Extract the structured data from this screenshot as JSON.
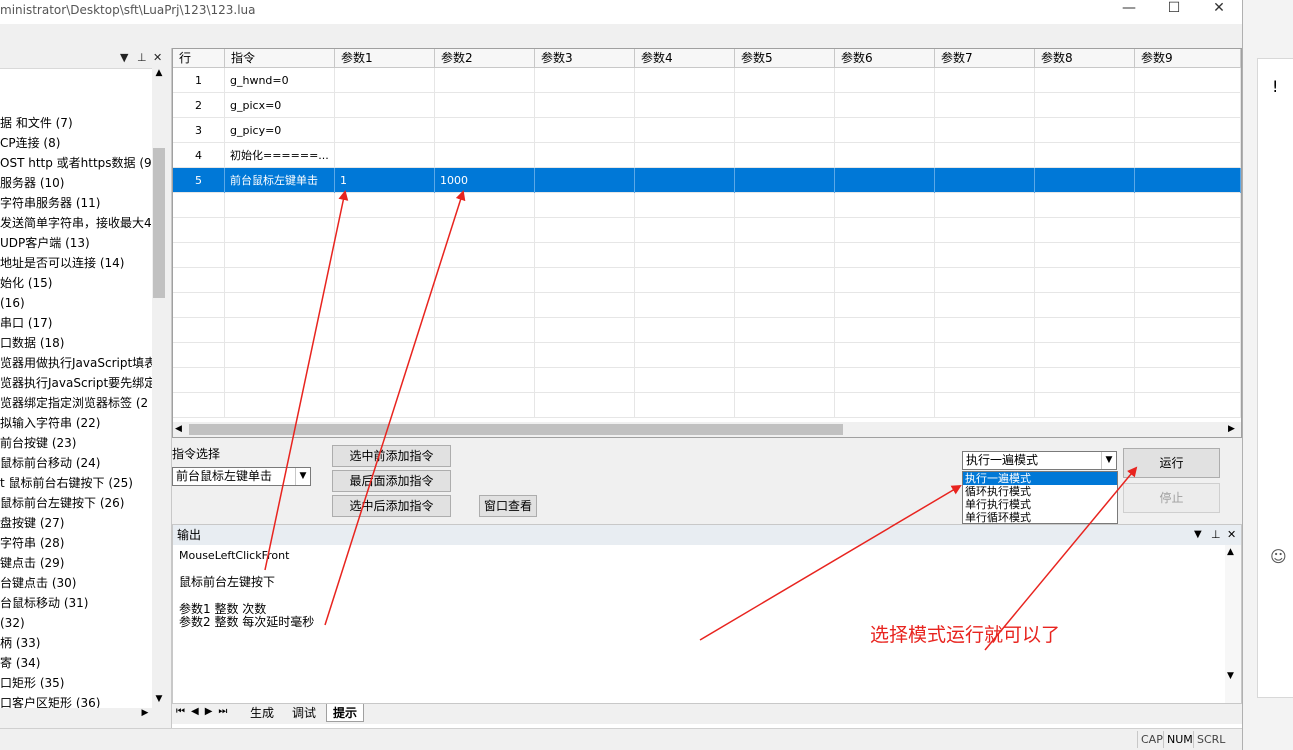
{
  "window": {
    "title": "ministrator\\Desktop\\sft\\LuaPrj\\123\\123.lua",
    "minimize_glyph": "—",
    "maximize_glyph": "☐",
    "close_glyph": "✕"
  },
  "left_panel": {
    "items": [
      "据 和文件 (7)",
      "CP连接 (8)",
      "OST http 或者https数据 (9)",
      "服务器 (10)",
      "字符串服务器 (11)",
      "发送简单字符串，接收最大4",
      "UDP客户端 (13)",
      "地址是否可以连接 (14)",
      "始化 (15)",
      "(16)",
      "串口 (17)",
      "口数据 (18)",
      "览器用做执行JavaScript填表",
      "览器执行JavaScript要先绑定",
      "览器绑定指定浏览器标签 (2",
      "拟输入字符串 (22)",
      "前台按键 (23)",
      "鼠标前台移动 (24)",
      "t  鼠标前台右键按下 (25)",
      "  鼠标前台左键按下 (26)",
      "盘按键 (27)",
      "字符串 (28)",
      "键点击 (29)",
      "台键点击 (30)",
      "台鼠标移动 (31)",
      "(32)",
      "柄 (33)",
      "寄 (34)",
      "口矩形 (35)",
      "口客户区矩形 (36)"
    ]
  },
  "grid": {
    "headers": [
      "行",
      "指令",
      "参数1",
      "参数2",
      "参数3",
      "参数4",
      "参数5",
      "参数6",
      "参数7",
      "参数8",
      "参数9"
    ],
    "rows": [
      {
        "n": "1",
        "cmd": "g_hwnd=0",
        "p1": "",
        "p2": ""
      },
      {
        "n": "2",
        "cmd": "g_picx=0",
        "p1": "",
        "p2": ""
      },
      {
        "n": "3",
        "cmd": "g_picy=0",
        "p1": "",
        "p2": ""
      },
      {
        "n": "4",
        "cmd": "初始化======...",
        "p1": "",
        "p2": ""
      },
      {
        "n": "5",
        "cmd": "前台鼠标左键单击",
        "p1": "1",
        "p2": "1000"
      }
    ],
    "selected_row": 5
  },
  "controls": {
    "cmd_select_label": "指令选择",
    "cmd_select_value": "前台鼠标左键单击",
    "btn_add_before": "选中前添加指令",
    "btn_add_last": "最后面添加指令",
    "btn_add_after": "选中后添加指令",
    "btn_window_view": "窗口查看",
    "mode_value": "执行一遍模式",
    "mode_options": [
      "执行一遍模式",
      "循环执行模式",
      "单行执行模式",
      "单行循环模式"
    ],
    "btn_run": "运行",
    "btn_stop": "停止"
  },
  "output": {
    "title": "输出",
    "lines": [
      "MouseLeftClickFront",
      "鼠标前台左键按下",
      "参数1 整数 次数",
      "参数2 整数 每次延时毫秒"
    ]
  },
  "tabs": [
    "生成",
    "调试",
    "提示"
  ],
  "active_tab": "提示",
  "status": [
    "CAP",
    "NUM",
    "SCRL"
  ],
  "annotation": {
    "text": "选择模式运行就可以了",
    "color": "#e8241f"
  },
  "colors": {
    "selection": "#0078d7"
  }
}
